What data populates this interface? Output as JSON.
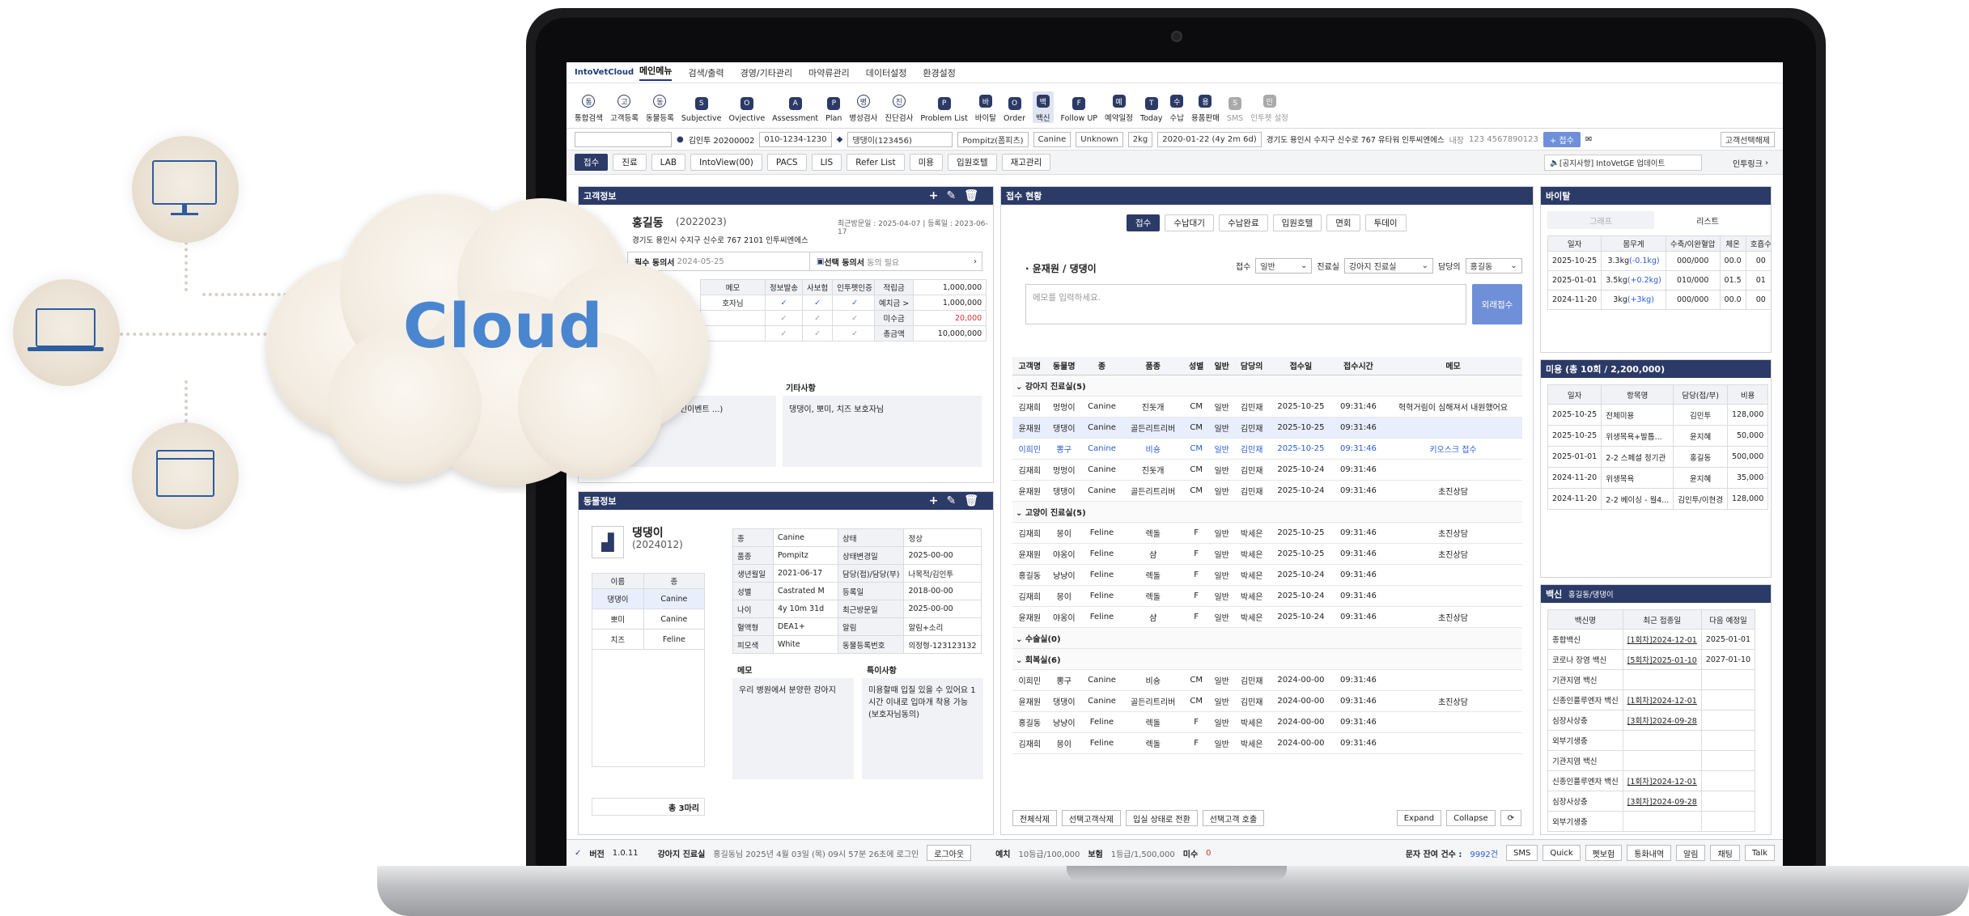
{
  "app": {
    "logo": "IntoVetCloud",
    "menus": [
      "메인메뉴",
      "검색/출력",
      "경영/기타관리",
      "마약류관리",
      "데이터설정",
      "환경설정"
    ]
  },
  "toolbar": [
    {
      "label": "통합검색",
      "icon": "search-icon"
    },
    {
      "label": "고객등록",
      "icon": "person-add-icon"
    },
    {
      "label": "동물등록",
      "icon": "paw-icon"
    },
    {
      "label": "Subjective",
      "icon": "s-badge-icon"
    },
    {
      "label": "Ovjective",
      "icon": "o-badge-icon"
    },
    {
      "label": "Assessment",
      "icon": "a-badge-icon"
    },
    {
      "label": "Plan",
      "icon": "p-badge-icon"
    },
    {
      "label": "병성검사",
      "icon": "magnifier-icon"
    },
    {
      "label": "진단검사",
      "icon": "magnifier-plus-icon"
    },
    {
      "label": "Problem List",
      "icon": "list-icon"
    },
    {
      "label": "바이탈",
      "icon": "heart-icon"
    },
    {
      "label": "Order",
      "icon": "order-arrow-icon"
    },
    {
      "label": "백신",
      "icon": "vaccine-heart-icon"
    },
    {
      "label": "Follow UP",
      "icon": "printer-icon"
    },
    {
      "label": "예약일정",
      "icon": "calendar-icon"
    },
    {
      "label": "Today",
      "icon": "calendar-today-icon"
    },
    {
      "label": "수납",
      "icon": "wallet-icon"
    },
    {
      "label": "용품판매",
      "icon": "cart-icon"
    },
    {
      "label": "SMS",
      "icon": "mail-icon"
    },
    {
      "label": "인투펫 설정",
      "icon": "settings-icon"
    }
  ],
  "patient": {
    "owner": "김인투 20200002",
    "phone": "010-1234-1230",
    "pet": "댕댕이(123456)",
    "breed": "Pompitz(폼피츠)",
    "species": "Canine",
    "sex": "Unknown",
    "weight": "2kg",
    "birth": "2020-01-22 (4y 2m 6d)",
    "address": "경기도 용인시 수지구 신수로 767 유타워 인투씨엔에스",
    "visit": "내장",
    "card": "123 4567890123",
    "accept": "+ 접수",
    "select": "고객선택해제"
  },
  "tabs": [
    "접수",
    "진료",
    "LAB",
    "IntoView(00)",
    "PACS",
    "LIS",
    "Refer List",
    "미용",
    "입원호텔",
    "재고관리"
  ],
  "notice": {
    "text": "[공지사항] IntoVetGE 업데이트",
    "link": "인투링크"
  },
  "customer": {
    "title": "고객정보",
    "name": "홍길동",
    "id": "(2022023)",
    "last": "최근방문일 : 2025-04-07 | 등록일 : 2023-06-17",
    "addr": "경기도 용인시 수지구 신수로 767 2101 인투씨엔에스",
    "consent1": "필수 동의서",
    "consent1_date": "2024-05-25",
    "consent2": "선택 동의서",
    "consent2_note": "동의 필요",
    "headers": [
      "메모",
      "정보발송",
      "사보험",
      "인투펫인증"
    ],
    "memo": "호자님",
    "fin": [
      [
        "적립금",
        "1,000,000"
      ],
      [
        "예치금 >",
        "1,000,000"
      ],
      [
        "미수금",
        "20,000"
      ],
      [
        "총금액",
        "10,000,000"
      ]
    ],
    "etc_label": "기타사항",
    "etc": "댕댕이, 뽀미, 치즈 보호자님",
    "note": "관(현금결제시 10% 할인이벤트 ...)"
  },
  "animal": {
    "title": "동물정보",
    "name": "댕댕이",
    "id": "(2024012)",
    "list_headers": [
      "이름",
      "종"
    ],
    "list": [
      [
        "댕댕이",
        "Canine"
      ],
      [
        "뽀미",
        "Canine"
      ],
      [
        "치즈",
        "Feline"
      ]
    ],
    "total": "총 3마리",
    "info": [
      [
        "종",
        "Canine",
        "상태",
        "정상"
      ],
      [
        "품종",
        "Pompitz",
        "상태변경일",
        "2025-00-00"
      ],
      [
        "생년월일",
        "2021-06-17",
        "담당(접)/담당(부)",
        "나목적/김인투"
      ],
      [
        "성별",
        "Castrated M",
        "등록일",
        "2018-00-00"
      ],
      [
        "나이",
        "4y 10m 31d",
        "최근방문일",
        "2025-00-00"
      ],
      [
        "혈액형",
        "DEA1+",
        "알림",
        "알림+소리"
      ],
      [
        "피모색",
        "White",
        "동물등록번호",
        "의정형-123123132"
      ]
    ],
    "memo_label": "메모",
    "memo": "우리 병원에서 분양한 강아지",
    "special_label": "특이사항",
    "special": "미용할때 입질 있을 수 있어요 1시간 이내로 입마개 착용 가능 (보호자님동의)"
  },
  "reception": {
    "title": "접수 현황",
    "subtabs": [
      "접수",
      "수납대기",
      "수납완료",
      "입원호텔",
      "면회",
      "투데이"
    ],
    "section": "· 윤재원 / 댕댕이",
    "f_label1": "접수",
    "f_val1": "일반",
    "f_label2": "진료실",
    "f_val2": "강아지 진료실",
    "f_label3": "담당의",
    "f_val3": "홍길동",
    "memo_ph": "메모를 입력하세요.",
    "btn": "외래접수",
    "headers": [
      "고객명",
      "동물명",
      "종",
      "품종",
      "성별",
      "일반",
      "담당의",
      "접수일",
      "접수시간",
      "메모"
    ],
    "rows": [
      {
        "g": "강아지 진료실(5)"
      },
      {
        "c": [
          "김재희",
          "멍멍이",
          "Canine",
          "진돗개",
          "CM",
          "일반",
          "김민재",
          "2025-10-25",
          "09:31:46",
          "혁혁거림이 심해져서 내원했어요"
        ]
      },
      {
        "c": [
          "윤재원",
          "댕댕이",
          "Canine",
          "골든리트리버",
          "CM",
          "일반",
          "김민재",
          "2025-10-25",
          "09:31:46",
          ""
        ],
        "s": "sel"
      },
      {
        "c": [
          "이희민",
          "뽕구",
          "Canine",
          "비숑",
          "CM",
          "일반",
          "김민재",
          "2025-10-25",
          "09:31:46",
          "키오스크 접수"
        ],
        "s": "hl"
      },
      {
        "c": [
          "김재희",
          "멍멍이",
          "Canine",
          "진돗개",
          "CM",
          "일반",
          "김민재",
          "2025-10-24",
          "09:31:46",
          ""
        ]
      },
      {
        "c": [
          "윤재원",
          "댕댕이",
          "Canine",
          "골든리트리버",
          "CM",
          "일반",
          "김민재",
          "2025-10-24",
          "09:31:46",
          "초진상담"
        ]
      },
      {
        "g": "고양이 진료실(5)"
      },
      {
        "c": [
          "김재희",
          "몽이",
          "Feline",
          "렉돌",
          "F",
          "일반",
          "박세은",
          "2025-10-25",
          "09:31:46",
          "초진상담"
        ]
      },
      {
        "c": [
          "윤재원",
          "야옹이",
          "Feline",
          "샴",
          "F",
          "일반",
          "박세은",
          "2025-10-25",
          "09:31:46",
          "초진상담"
        ]
      },
      {
        "c": [
          "홍길동",
          "냥냥이",
          "Feline",
          "렉돌",
          "F",
          "일반",
          "박세은",
          "2025-10-24",
          "09:31:46",
          ""
        ]
      },
      {
        "c": [
          "김재희",
          "몽이",
          "Feline",
          "렉돌",
          "F",
          "일반",
          "박세은",
          "2025-10-24",
          "09:31:46",
          ""
        ]
      },
      {
        "c": [
          "윤재원",
          "야옹이",
          "Feline",
          "샴",
          "F",
          "일반",
          "박세은",
          "2025-10-24",
          "09:31:46",
          "초진상담"
        ]
      },
      {
        "g": "수술실(0)"
      },
      {
        "g": "회복실(6)"
      },
      {
        "c": [
          "이희민",
          "뽕구",
          "Canine",
          "비숑",
          "CM",
          "일반",
          "김민재",
          "2024-00-00",
          "09:31:46",
          ""
        ]
      },
      {
        "c": [
          "윤재원",
          "댕댕이",
          "Canine",
          "골든리트리버",
          "CM",
          "일반",
          "김민재",
          "2024-00-00",
          "09:31:46",
          "초진상담"
        ]
      },
      {
        "c": [
          "홍길동",
          "냥냥이",
          "Feline",
          "렉돌",
          "F",
          "일반",
          "박세은",
          "2024-00-00",
          "09:31:46",
          ""
        ]
      },
      {
        "c": [
          "김재희",
          "몽이",
          "Feline",
          "렉돌",
          "F",
          "일반",
          "박세은",
          "2024-00-00",
          "09:31:46",
          ""
        ]
      }
    ],
    "footer_btns": [
      "전체삭제",
      "선택고객삭제",
      "입실 상태로 전환",
      "선택고객 호출"
    ],
    "expand": "Expand",
    "collapse": "Collapse"
  },
  "vital": {
    "title": "바이탈",
    "tabs": [
      "그래프",
      "리스트"
    ],
    "headers": [
      "일자",
      "몸무게",
      "수축/이완혈압",
      "체온",
      "호흡수"
    ],
    "rows": [
      [
        "2025-10-25",
        "3.3kg",
        "(-0.1kg)",
        "000/000",
        "00.0",
        "00"
      ],
      [
        "2025-01-01",
        "3.5kg",
        "(+0.2kg)",
        "010/000",
        "01.5",
        "01"
      ],
      [
        "2024-11-20",
        "3kg",
        "(+3kg)",
        "000/000",
        "00.0",
        "00"
      ]
    ]
  },
  "beauty": {
    "title": "미용 (총 10회 / 2,200,000)",
    "headers": [
      "일자",
      "항목명",
      "담당(접/부)",
      "비용"
    ],
    "rows": [
      [
        "2025-10-25",
        "전체미용",
        "김민투",
        "128,000"
      ],
      [
        "2025-10-25",
        "위생목욕+발톱...",
        "윤지혜",
        "50,000"
      ],
      [
        "2025-01-01",
        "2-2 스페셜 정기관",
        "홍길동",
        "500,000"
      ],
      [
        "2024-11-20",
        "위생목욕",
        "윤지혜",
        "35,000"
      ],
      [
        "2024-11-20",
        "2-2 베이싱 - 월4...",
        "김인투/이현경",
        "128,000"
      ]
    ]
  },
  "vaccine": {
    "title": "백신",
    "sub": "홍길동/댕댕이",
    "headers": [
      "백신명",
      "최근 접종일",
      "다음 예정일"
    ],
    "rows": [
      [
        "종합백신",
        "[1회차]2024-12-01",
        "2025-01-01"
      ],
      [
        "코로나 장염 백신",
        "[5회차]2025-01-10",
        "2027-01-10"
      ],
      [
        "기관지염 백신",
        "",
        ""
      ],
      [
        "신종인플루엔자 백신",
        "[1회차]2024-12-01",
        ""
      ],
      [
        "심장사상충",
        "[3회차]2024-09-28",
        ""
      ],
      [
        "외부기생충",
        "",
        ""
      ],
      [
        "기관지염 백신",
        "",
        ""
      ],
      [
        "신종인플루엔자 백신",
        "[1회차]2024-12-01",
        ""
      ],
      [
        "심장사상충",
        "[3회차]2024-09-28",
        ""
      ],
      [
        "외부기생충",
        "",
        ""
      ]
    ]
  },
  "status": {
    "version_label": "버전",
    "version": "1.0.11",
    "room": "강아지 진료실",
    "login": "홍길동님 2025년 4월 03일 (목) 09시 57분 26초에 로그인",
    "logout": "로그아웃",
    "deposit_label": "예치",
    "deposit": "10등급/100,000",
    "insurance_label": "보험",
    "insurance": "1등급/1,500,000",
    "unpaid_label": "미수",
    "unpaid": "0",
    "sms_label": "문자 잔여 건수 :",
    "sms": "9992건",
    "btns": [
      "SMS",
      "Quick",
      "펫보험",
      "통화내역",
      "알림",
      "채팅",
      "Talk"
    ]
  },
  "cloud": {
    "label": "Cloud",
    "color": "#4a86cf"
  }
}
